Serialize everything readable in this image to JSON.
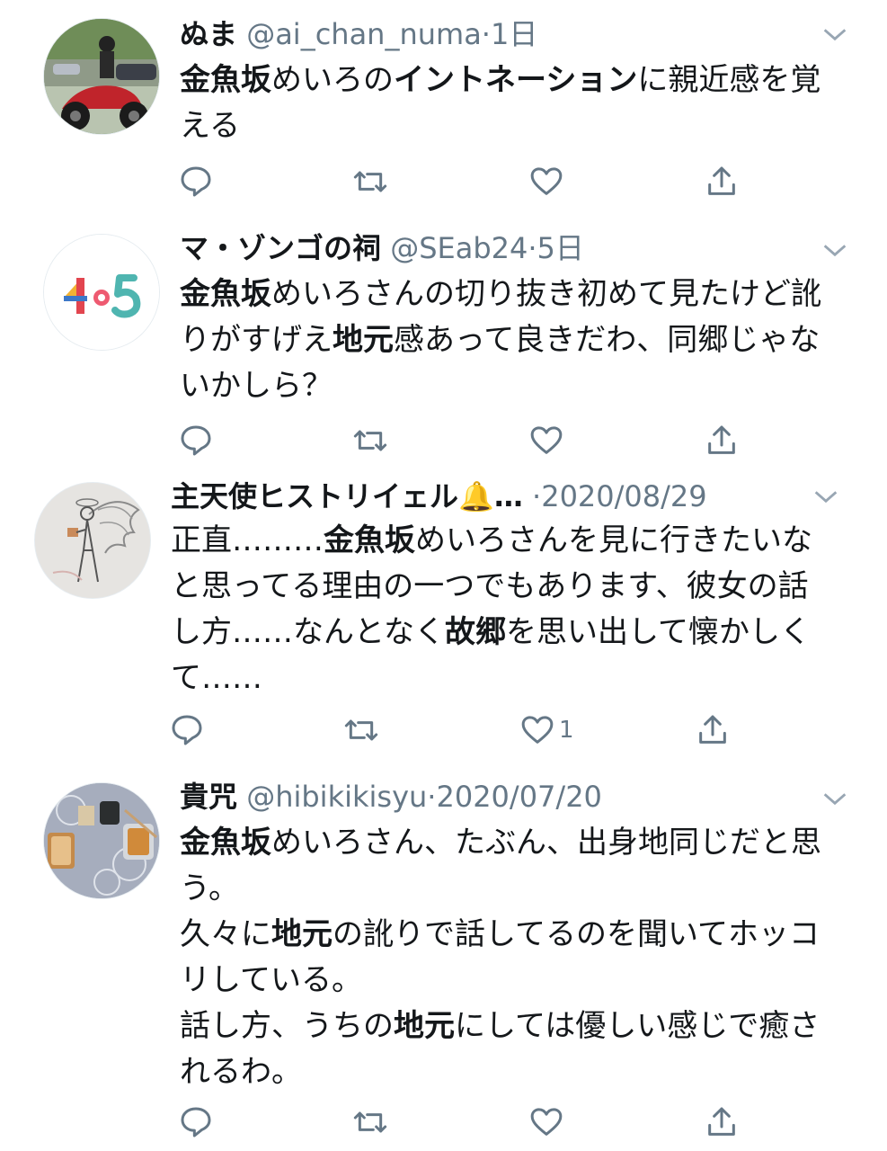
{
  "colors": {
    "text": "#14171a",
    "secondary": "#657786",
    "icon": "#657786"
  },
  "tweets": [
    {
      "name": "ぬま",
      "handle": "@ai_chan_numa",
      "time": "1日",
      "avatar_icon": "motorcycle-photo-avatar",
      "body_segments": [
        {
          "text": "金魚坂",
          "bold": true
        },
        {
          "text": "めいろの",
          "bold": false
        },
        {
          "text": "イントネーション",
          "bold": true
        },
        {
          "text": "に親近感を覚える",
          "bold": false
        }
      ],
      "like_count": ""
    },
    {
      "name": "マ・ゾンゴの祠",
      "handle": "@SEab24",
      "time": "5日",
      "avatar_icon": "logo-105-avatar",
      "body_segments": [
        {
          "text": "金魚坂",
          "bold": true
        },
        {
          "text": "めいろさんの切り抜き初めて見たけど訛りがすげえ",
          "bold": false
        },
        {
          "text": "地元",
          "bold": true
        },
        {
          "text": "感あって良きだわ、同郷じゃないかしら？",
          "bold": false
        }
      ],
      "like_count": ""
    },
    {
      "name": "主天使ヒストリイェル🔔…",
      "handle": "",
      "time": "2020/08/29",
      "avatar_icon": "angel-drawing-avatar",
      "body_segments": [
        {
          "text": "正直………",
          "bold": false
        },
        {
          "text": "金魚坂",
          "bold": true
        },
        {
          "text": "めいろさんを見に行きたいなと思ってる理由の一つでもあります、彼女の話し方……なんとなく",
          "bold": false
        },
        {
          "text": "故郷",
          "bold": true
        },
        {
          "text": "を思い出して懐かしくて……",
          "bold": false
        }
      ],
      "like_count": "1"
    },
    {
      "name": "貴咒",
      "handle": "@hibikikisyu",
      "time": "2020/07/20",
      "avatar_icon": "food-photo-avatar",
      "body_segments": [
        {
          "text": "金魚坂",
          "bold": true
        },
        {
          "text": "めいろさん、たぶん、出身地同じだと思う。\n久々に",
          "bold": false
        },
        {
          "text": "地元",
          "bold": true
        },
        {
          "text": "の訛りで話してるのを聞いてホッコリしている。\n話し方、うちの",
          "bold": false
        },
        {
          "text": "地元",
          "bold": true
        },
        {
          "text": "にしては優しい感じで癒されるわ。",
          "bold": false
        }
      ],
      "like_count": ""
    }
  ]
}
